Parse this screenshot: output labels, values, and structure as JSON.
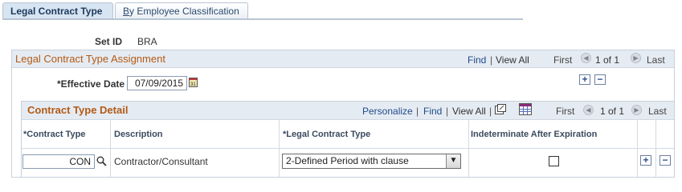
{
  "tabs": [
    {
      "label": "Legal Contract Type",
      "active": true
    },
    {
      "label_first": "B",
      "label_rest": "y Employee Classification",
      "active": false
    }
  ],
  "setid": {
    "label": "Set ID",
    "value": "BRA"
  },
  "assignment": {
    "title": "Legal Contract Type Assignment",
    "find": "Find",
    "separator": "|",
    "view_all": "View All",
    "first": "First",
    "page": "1 of 1",
    "last": "Last",
    "effective_date_label": "*Effective Date",
    "effective_date_value": "07/09/2015"
  },
  "detail": {
    "title": "Contract Type Detail",
    "personalize": "Personalize",
    "find": "Find",
    "view_all": "View All",
    "separator": "|",
    "first": "First",
    "page": "1 of 1",
    "last": "Last",
    "columns": [
      "*Contract Type",
      "Description",
      "*Legal Contract Type",
      "Indeterminate After Expiration"
    ],
    "row": {
      "contract_type": "CON",
      "description": "Contractor/Consultant",
      "legal_contract_type": "2-Defined Period with clause",
      "indeterminate": false
    }
  },
  "icons": {
    "calendar": "calendar-icon",
    "lookup": "magnifier-icon",
    "zoom": "new-window-icon",
    "download": "spreadsheet-icon",
    "add": "plus-icon",
    "remove": "minus-icon",
    "prev": "arrow-left-icon",
    "next": "arrow-right-icon"
  }
}
